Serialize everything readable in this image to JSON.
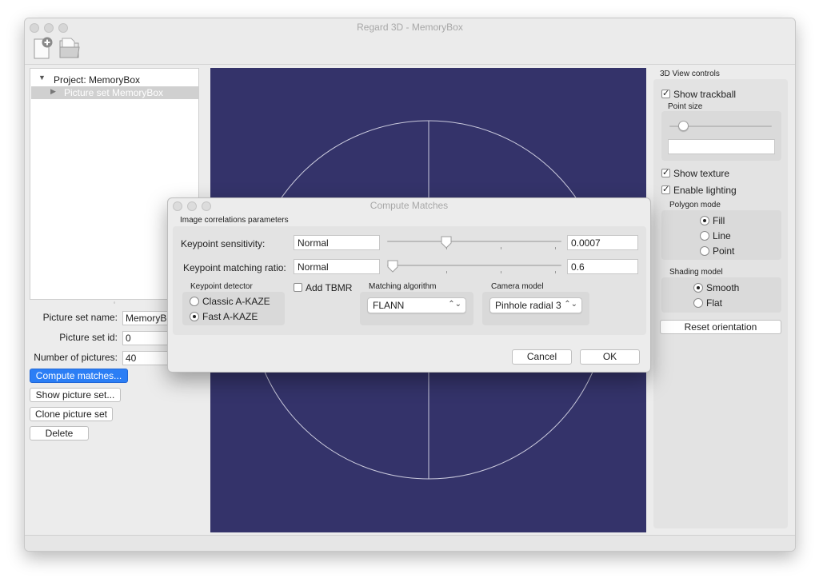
{
  "window": {
    "title": "Regard 3D - MemoryBox"
  },
  "toolbar": {
    "new_project_icon": "new-project-icon",
    "open_project_icon": "open-project-icon"
  },
  "tree": {
    "project_label": "Project: MemoryBox",
    "picture_set_label": "Picture set MemoryBox"
  },
  "properties": {
    "name_label": "Picture set name:",
    "name_value": "MemoryBox",
    "id_label": "Picture set id:",
    "id_value": "0",
    "count_label": "Number of pictures:",
    "count_value": "40"
  },
  "actions": {
    "compute": "Compute matches...",
    "show": "Show picture set...",
    "clone": "Clone picture set",
    "delete": "Delete"
  },
  "view_controls": {
    "title": "3D View controls",
    "show_trackball": "Show trackball",
    "show_trackball_checked": true,
    "point_size_label": "Point size",
    "point_size_fraction": 0.14,
    "point_size_value": "",
    "show_texture": "Show texture",
    "show_texture_checked": true,
    "enable_lighting": "Enable lighting",
    "enable_lighting_checked": true,
    "polygon_mode_label": "Polygon mode",
    "polygon_options": [
      "Fill",
      "Line",
      "Point"
    ],
    "polygon_selected": "Fill",
    "shading_label": "Shading model",
    "shading_options": [
      "Smooth",
      "Flat"
    ],
    "shading_selected": "Smooth",
    "reset_orientation": "Reset orientation"
  },
  "dialog": {
    "title": "Compute Matches",
    "section_title": "Image correlations parameters",
    "keypoint_sensitivity_label": "Keypoint sensitivity:",
    "keypoint_sensitivity_text": "Normal",
    "keypoint_sensitivity_value": "0.0007",
    "keypoint_sensitivity_fraction": 0.34,
    "matching_ratio_label": "Keypoint matching ratio:",
    "matching_ratio_text": "Normal",
    "matching_ratio_value": "0.6",
    "matching_ratio_fraction": 0.03,
    "detector_label": "Keypoint detector",
    "detector_options": [
      "Classic A-KAZE",
      "Fast A-KAZE"
    ],
    "detector_selected": "Fast A-KAZE",
    "add_tbmr": "Add TBMR",
    "add_tbmr_checked": false,
    "matching_algorithm_label": "Matching algorithm",
    "matching_algorithm_value": "FLANN",
    "camera_model_label": "Camera model",
    "camera_model_value": "Pinhole radial 3",
    "cancel": "Cancel",
    "ok": "OK"
  },
  "colors": {
    "viewport_bg": "#34336a",
    "trackball": "#c9c9dc",
    "accent": "#2b7ef5"
  }
}
